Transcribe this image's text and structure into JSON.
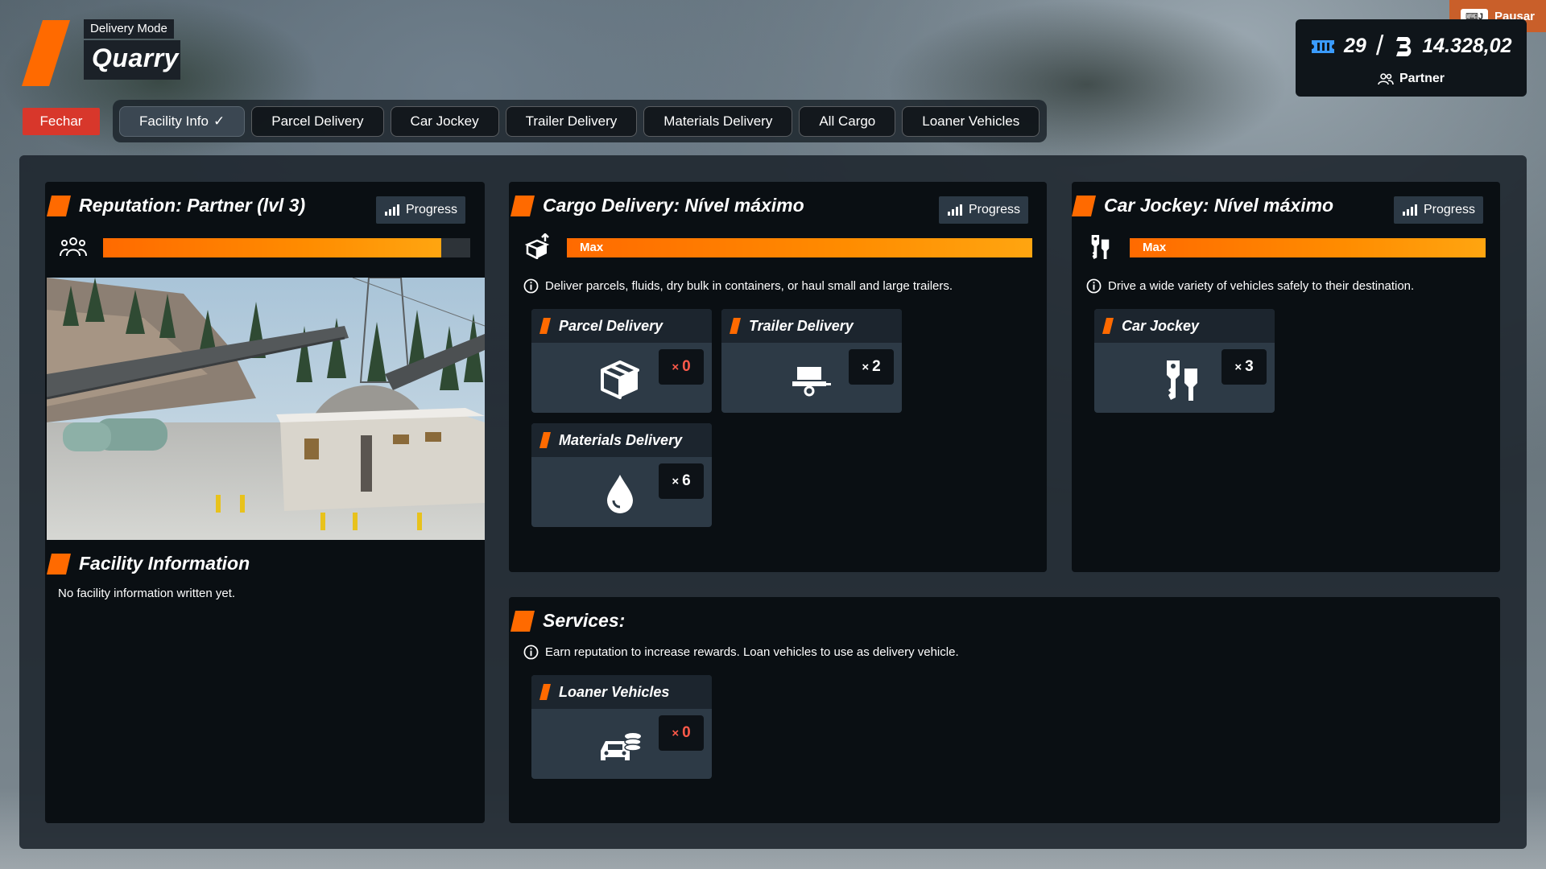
{
  "header": {
    "mode_label": "Delivery Mode",
    "facility_name": "Quarry",
    "close_label": "Fechar"
  },
  "tabs": [
    {
      "label": "Facility Info",
      "active": true,
      "check": "✓"
    },
    {
      "label": "Parcel Delivery"
    },
    {
      "label": "Car Jockey"
    },
    {
      "label": "Trailer Delivery"
    },
    {
      "label": "Materials Delivery"
    },
    {
      "label": "All Cargo"
    },
    {
      "label": "Loaner Vehicles"
    }
  ],
  "top_right": {
    "pause_label": "Pausar",
    "pause_key_label": "⌨J",
    "tickets": "29",
    "separator": "/",
    "bucks": "14.328,02",
    "rank": "Partner"
  },
  "reputation": {
    "title": "Reputation: Partner (lvl 3)",
    "progress_label": "Progress",
    "progress": 0.92
  },
  "facility_info": {
    "title": "Facility Information",
    "text": "No facility information written yet."
  },
  "cargo": {
    "title": "Cargo Delivery: Nível máximo",
    "progress_label": "Progress",
    "bar_label": "Max",
    "progress": 1.0,
    "info": "Deliver parcels, fluids, dry bulk in containers, or haul small and large trailers.",
    "jobs": [
      {
        "title": "Parcel Delivery",
        "count_prefix": "×",
        "count": "0",
        "icon": "box-icon"
      },
      {
        "title": "Trailer Delivery",
        "count_prefix": "×",
        "count": "2",
        "icon": "trailer-icon"
      },
      {
        "title": "Materials Delivery",
        "count_prefix": "×",
        "count": "6",
        "icon": "droplet-icon"
      }
    ]
  },
  "car_jockey": {
    "title": "Car Jockey: Nível máximo",
    "progress_label": "Progress",
    "bar_label": "Max",
    "progress": 1.0,
    "info": "Drive a wide variety of vehicles safely to their destination.",
    "jobs": [
      {
        "title": "Car Jockey",
        "count_prefix": "×",
        "count": "3",
        "icon": "car-keys-icon"
      }
    ]
  },
  "services": {
    "title": "Services:",
    "info": "Earn reputation to increase rewards. Loan vehicles to use as delivery vehicle.",
    "jobs": [
      {
        "title": "Loaner Vehicles",
        "count_prefix": "×",
        "count": "0",
        "icon": "loaner-car-icon"
      }
    ]
  },
  "colors": {
    "accent": "#ff6a00",
    "close_red": "#d8372b",
    "pause_orange": "#c95f2a",
    "ticket_blue": "#3a9bff",
    "zero_count": "#ff5a4a"
  }
}
